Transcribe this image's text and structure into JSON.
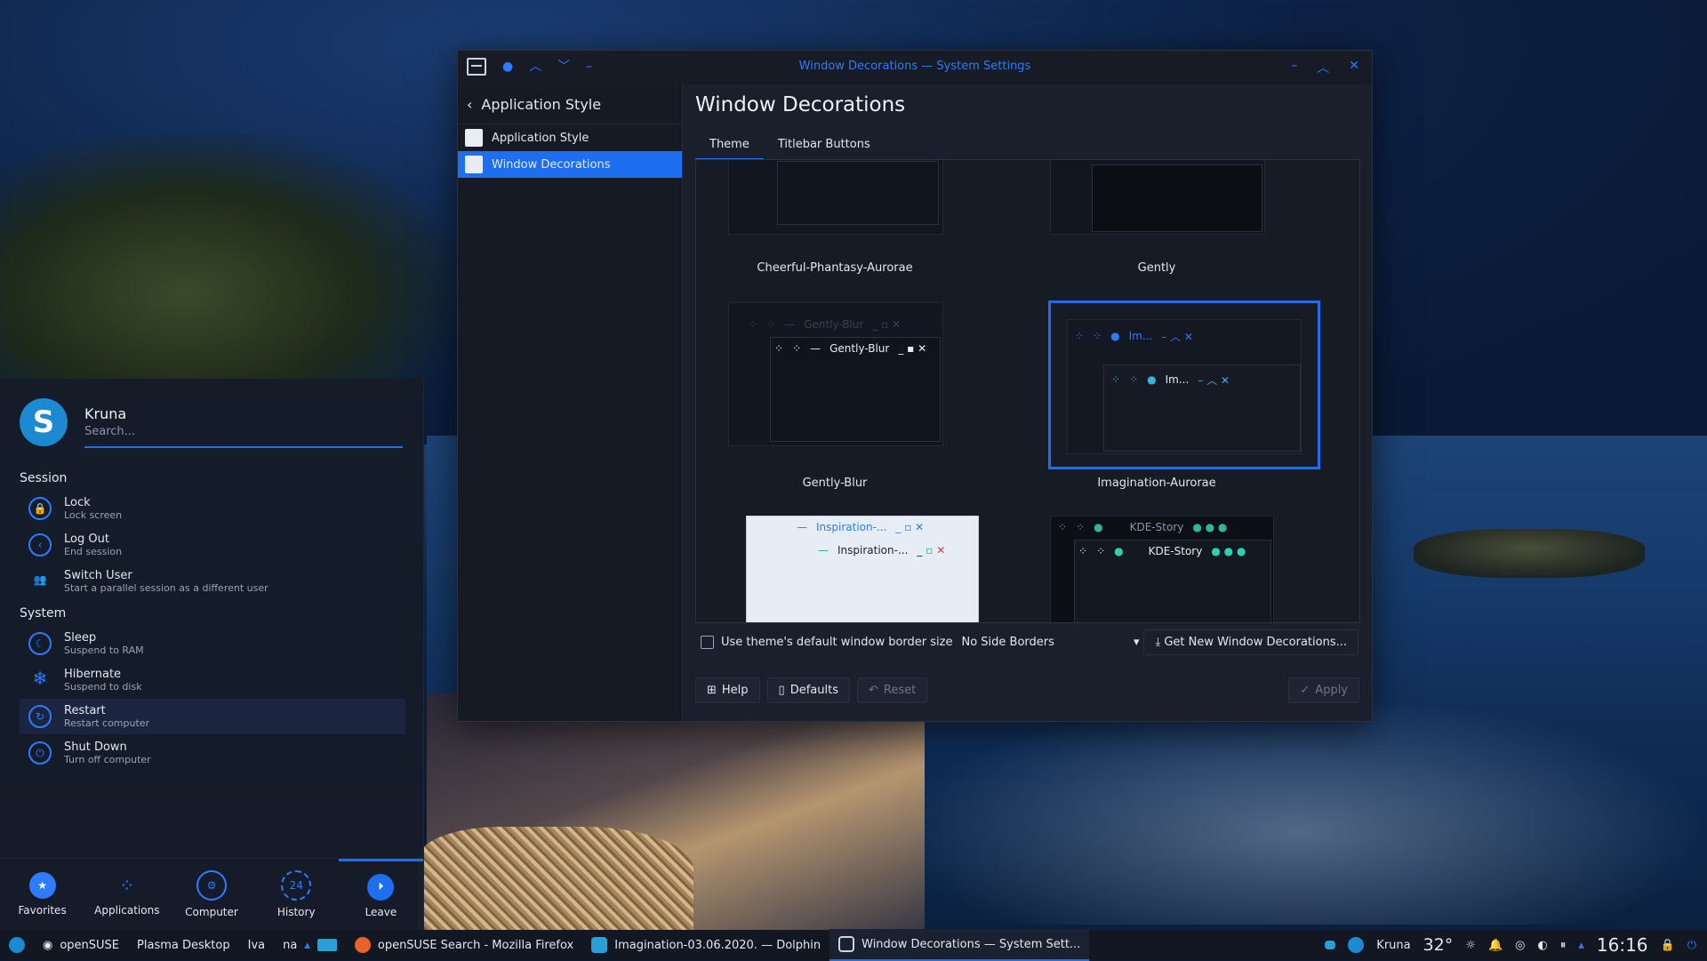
{
  "window": {
    "title": "Window Decorations — System Settings",
    "sidebar_header": "Application Style",
    "sidebar_items": [
      "Application Style",
      "Window Decorations"
    ],
    "page_title": "Window Decorations",
    "tabs": [
      "Theme",
      "Titlebar Buttons"
    ],
    "themes": [
      {
        "name": "Cheerful-Phantasy-Aurorae",
        "preview_title": ""
      },
      {
        "name": "Gently",
        "preview_title": ""
      },
      {
        "name": "Gently-Blur",
        "preview_title": "Gently-Blur"
      },
      {
        "name": "Imagination-Aurorae",
        "preview_title": "Im..."
      },
      {
        "name": "",
        "preview_title": "Inspiration-..."
      },
      {
        "name": "",
        "preview_title": "KDE-Story"
      }
    ],
    "border_checkbox_label": "Use theme's default window border size",
    "border_size": "No Side Borders",
    "get_new": "Get New Window Decorations...",
    "buttons": {
      "help": "Help",
      "defaults": "Defaults",
      "reset": "Reset",
      "apply": "Apply"
    }
  },
  "launcher": {
    "user": "Kruna",
    "search_placeholder": "Search...",
    "sections": {
      "session": "Session",
      "system": "System"
    },
    "session_items": [
      {
        "title": "Lock",
        "subtitle": "Lock screen"
      },
      {
        "title": "Log Out",
        "subtitle": "End session"
      },
      {
        "title": "Switch User",
        "subtitle": "Start a parallel session as a different user"
      }
    ],
    "system_items": [
      {
        "title": "Sleep",
        "subtitle": "Suspend to RAM"
      },
      {
        "title": "Hibernate",
        "subtitle": "Suspend to disk"
      },
      {
        "title": "Restart",
        "subtitle": "Restart computer"
      },
      {
        "title": "Shut Down",
        "subtitle": "Turn off computer"
      }
    ],
    "tabs": [
      "Favorites",
      "Applications",
      "Computer",
      "History",
      "Leave"
    ],
    "history_badge": "24"
  },
  "taskbar": {
    "distro": "openSUSE",
    "desktop": "Plasma Desktop",
    "pager": [
      "Iva",
      "na"
    ],
    "tasks": [
      "openSUSE Search - Mozilla Firefox",
      "Imagination-03.06.2020. — Dolphin",
      "Window Decorations — System Sett..."
    ],
    "tray_user": "Kruna",
    "temperature": "32°",
    "clock": "16:16"
  },
  "colors": {
    "accent": "#1d6ff0",
    "panel": "#121722",
    "window": "#1a1f2b"
  }
}
